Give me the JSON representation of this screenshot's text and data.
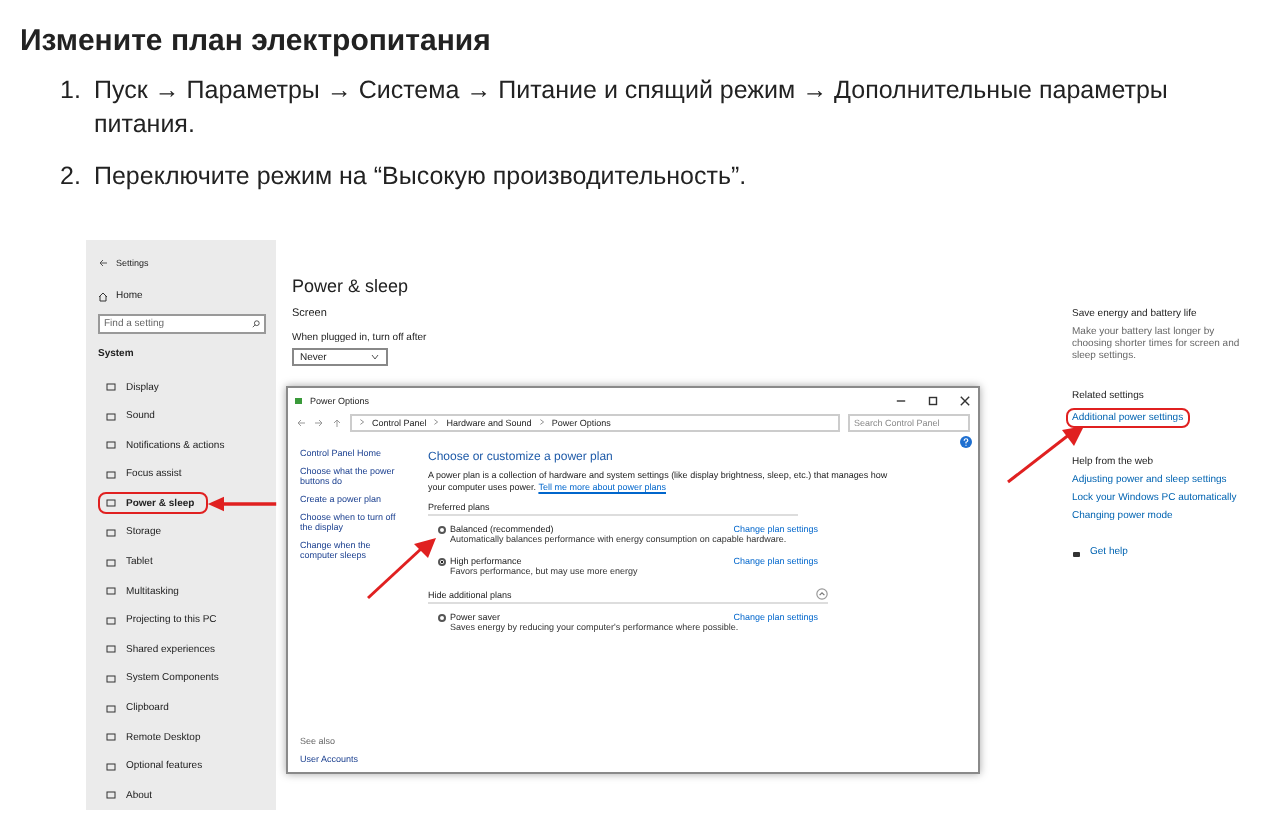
{
  "heading": "Измените план электропитания",
  "steps": [
    {
      "number": "1.",
      "text": "Пуск → Параметры → Система → Питание и спящий режим → Дополнительные параметры питания."
    },
    {
      "number": "2.",
      "text": "Переключите режим на “Высокую производительность”."
    }
  ],
  "screenshot": {
    "settings_title": "Settings",
    "home": "Home",
    "search_placeholder": "Find a setting",
    "section": "System",
    "nav_items": [
      {
        "label": "Display",
        "selected": false
      },
      {
        "label": "Sound",
        "selected": false
      },
      {
        "label": "Notifications & actions",
        "selected": false
      },
      {
        "label": "Focus assist",
        "selected": false
      },
      {
        "label": "Power & sleep",
        "selected": true
      },
      {
        "label": "Storage",
        "selected": false
      },
      {
        "label": "Tablet",
        "selected": false
      },
      {
        "label": "Multitasking",
        "selected": false
      },
      {
        "label": "Projecting to this PC",
        "selected": false
      },
      {
        "label": "Shared experiences",
        "selected": false
      },
      {
        "label": "System Components",
        "selected": false
      },
      {
        "label": "Clipboard",
        "selected": false
      },
      {
        "label": "Remote Desktop",
        "selected": false
      },
      {
        "label": "Optional features",
        "selected": false
      },
      {
        "label": "About",
        "selected": false
      }
    ],
    "page_title": "Power & sleep",
    "page_section": "Screen",
    "field_label": "When plugged in, turn off after",
    "dropdown_value": "Never",
    "side_title": "Save energy and battery life",
    "side_text": "Make your battery last longer by choosing shorter times for screen and sleep settings.",
    "related_title": "Related settings",
    "related_links": [
      {
        "label": "Additional power settings",
        "highlighted": true
      }
    ],
    "help_title": "Help from the web",
    "help_links": [
      "Adjusting power and sleep settings",
      "Lock your Windows PC automatically",
      "Changing power mode"
    ],
    "get_help": "Get help",
    "power_options": {
      "title": "Power Options",
      "breadcrumb": [
        "Control Panel",
        "Hardware and Sound",
        "Power Options"
      ],
      "search_placeholder": "Search Control Panel",
      "left_links": [
        "Control Panel Home",
        "Choose what the power buttons do",
        "Create a power plan",
        "Choose when to turn off the display",
        "Change when the computer sleeps"
      ],
      "see_also": "See also",
      "see_also_links": [
        "User Accounts"
      ],
      "heading": "Choose or customize a power plan",
      "description": "A power plan is a collection of hardware and system settings (like display brightness, sleep, etc.) that manages how your computer uses power.",
      "description_link": "Tell me more about power plans",
      "preferred_title": "Preferred plans",
      "plans": [
        {
          "name": "Balanced (recommended)",
          "text": "Automatically balances performance with energy consumption on capable hardware.",
          "link": "Change plan settings",
          "selected": false
        },
        {
          "name": "High performance",
          "text": "Favors performance, but may use more energy",
          "link": "Change plan settings",
          "selected": true
        }
      ],
      "hidden_title": "Hide additional plans",
      "extra_plans": [
        {
          "name": "Power saver",
          "text": "Saves energy by reducing your computer's performance where possible.",
          "link": "Change plan settings",
          "selected": false
        }
      ]
    }
  }
}
